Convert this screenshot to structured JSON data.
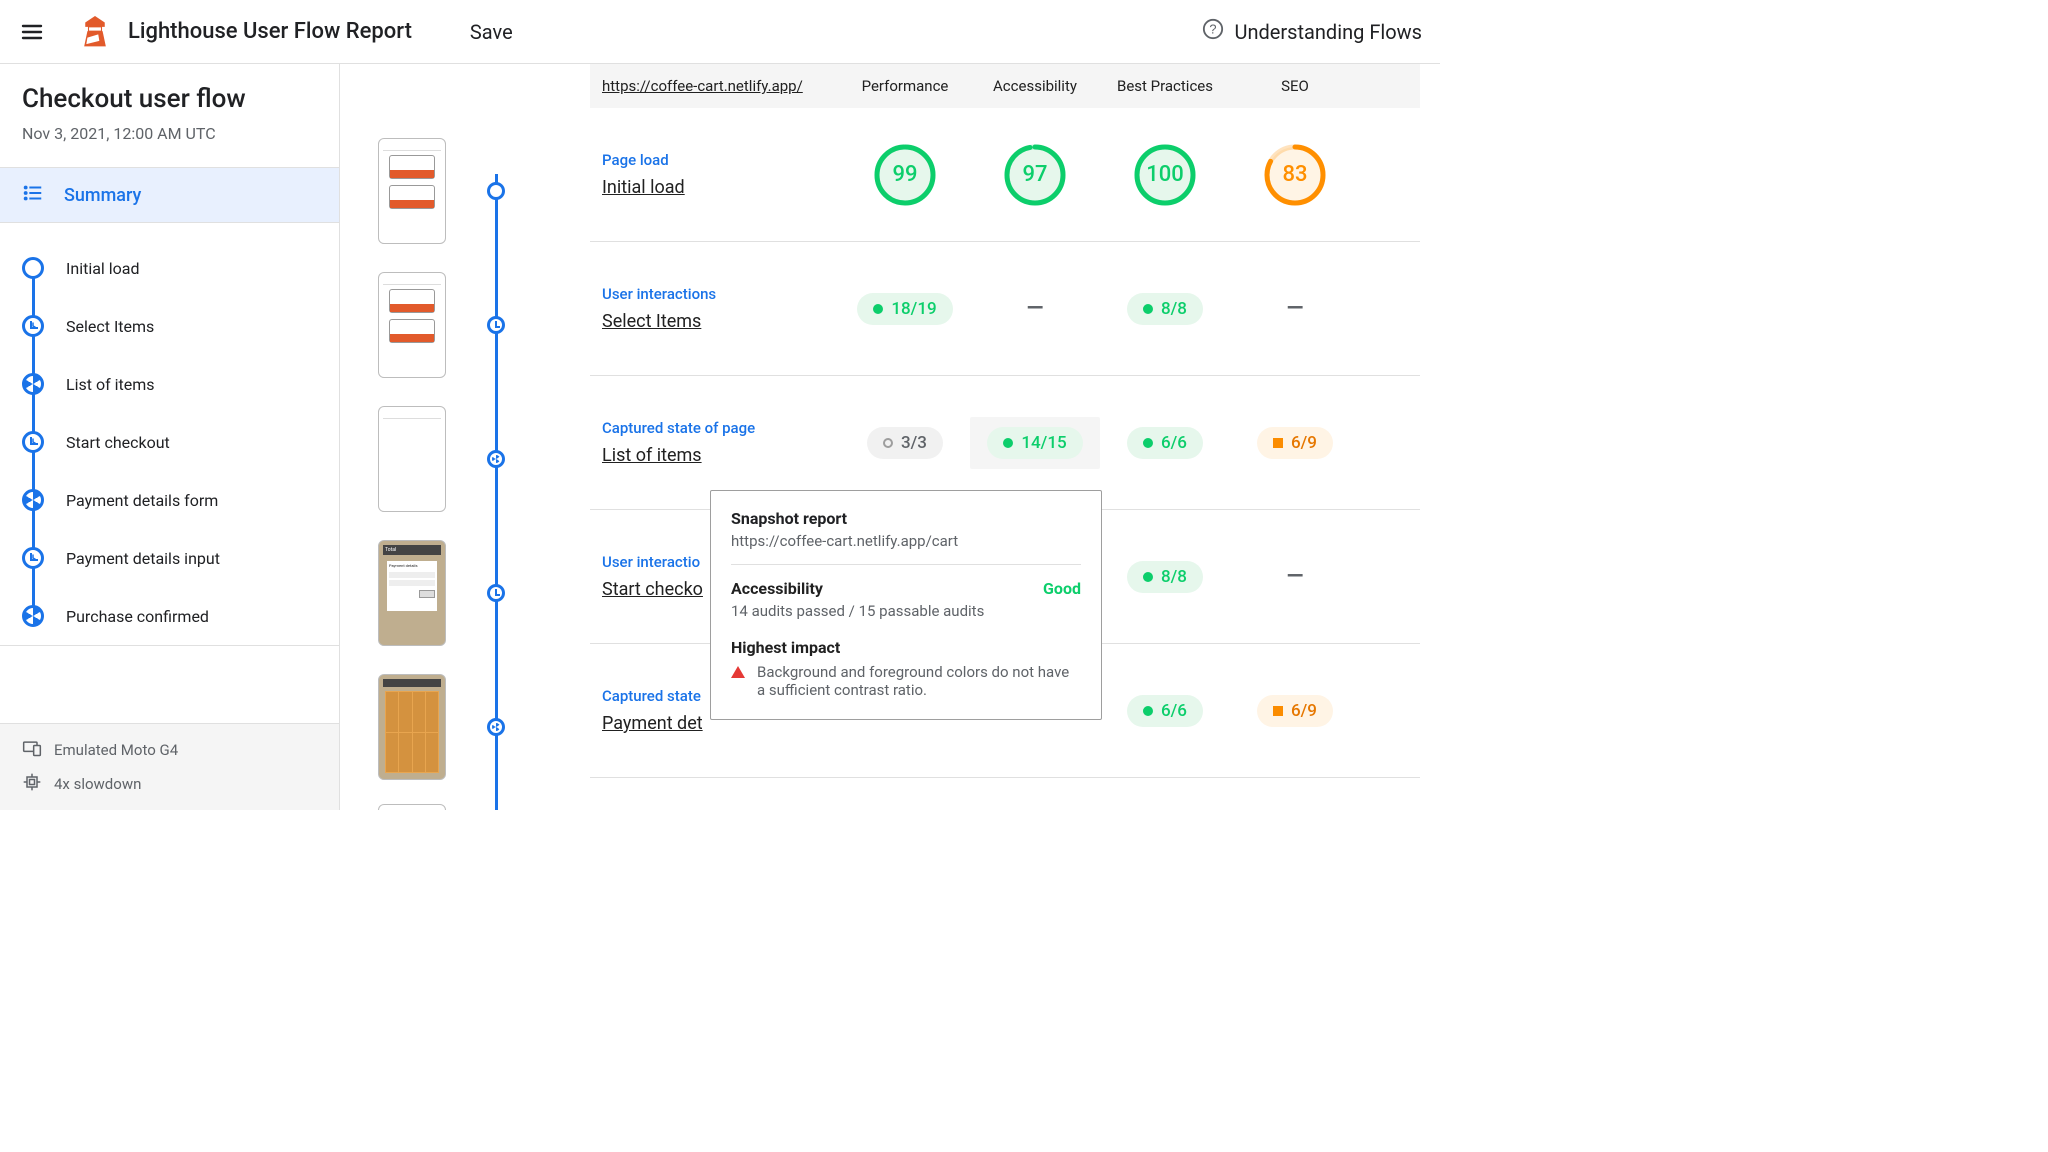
{
  "header": {
    "title": "Lighthouse User Flow Report",
    "save": "Save",
    "understanding": "Understanding Flows"
  },
  "sidebar": {
    "flow_title": "Checkout user flow",
    "date": "Nov 3, 2021, 12:00 AM UTC",
    "summary": "Summary",
    "steps": [
      {
        "label": "Initial load",
        "icon": "circle"
      },
      {
        "label": "Select Items",
        "icon": "clock"
      },
      {
        "label": "List of items",
        "icon": "aperture"
      },
      {
        "label": "Start checkout",
        "icon": "clock"
      },
      {
        "label": "Payment details form",
        "icon": "aperture"
      },
      {
        "label": "Payment details input",
        "icon": "clock"
      },
      {
        "label": "Purchase confirmed",
        "icon": "aperture"
      }
    ],
    "device": "Emulated Moto G4",
    "throttle": "4x slowdown"
  },
  "table": {
    "url": "https://coffee-cart.netlify.app/",
    "cols": [
      "Performance",
      "Accessibility",
      "Best Practices",
      "SEO"
    ],
    "rows": [
      {
        "kind": "Page load",
        "name": "Initial load",
        "cells": [
          {
            "type": "gauge",
            "value": 99,
            "color": "green"
          },
          {
            "type": "gauge",
            "value": 97,
            "color": "green"
          },
          {
            "type": "gauge",
            "value": 100,
            "color": "green"
          },
          {
            "type": "gauge",
            "value": 83,
            "color": "orange"
          }
        ]
      },
      {
        "kind": "User interactions",
        "name": "Select Items",
        "cells": [
          {
            "type": "chip",
            "text": "18/19",
            "style": "green"
          },
          {
            "type": "dash"
          },
          {
            "type": "chip",
            "text": "8/8",
            "style": "green"
          },
          {
            "type": "dash"
          }
        ]
      },
      {
        "kind": "Captured state of page",
        "name": "List of items",
        "cells": [
          {
            "type": "chip",
            "text": "3/3",
            "style": "hollow"
          },
          {
            "type": "chip",
            "text": "14/15",
            "style": "green",
            "hover": true
          },
          {
            "type": "chip",
            "text": "6/6",
            "style": "green"
          },
          {
            "type": "chip",
            "text": "6/9",
            "style": "orange"
          }
        ]
      },
      {
        "kind": "User interactions",
        "name": "Start checkout",
        "truncated_kind": "User interactio",
        "truncated_name": "Start checko",
        "cells": [
          {
            "type": "blank"
          },
          {
            "type": "blank"
          },
          {
            "type": "chip",
            "text": "8/8",
            "style": "green"
          },
          {
            "type": "dash"
          }
        ]
      },
      {
        "kind": "Captured state of page",
        "name": "Payment details form",
        "truncated_kind": "Captured state",
        "truncated_name": "Payment det",
        "cells": [
          {
            "type": "blank"
          },
          {
            "type": "blank"
          },
          {
            "type": "chip",
            "text": "6/6",
            "style": "green"
          },
          {
            "type": "chip",
            "text": "6/9",
            "style": "orange"
          }
        ]
      }
    ]
  },
  "tooltip": {
    "title": "Snapshot report",
    "url": "https://coffee-cart.netlify.app/cart",
    "category": "Accessibility",
    "rating": "Good",
    "audits": "14 audits passed / 15 passable audits",
    "impact_title": "Highest impact",
    "impact_text": "Background and foreground colors do not have a sufficient contrast ratio."
  }
}
